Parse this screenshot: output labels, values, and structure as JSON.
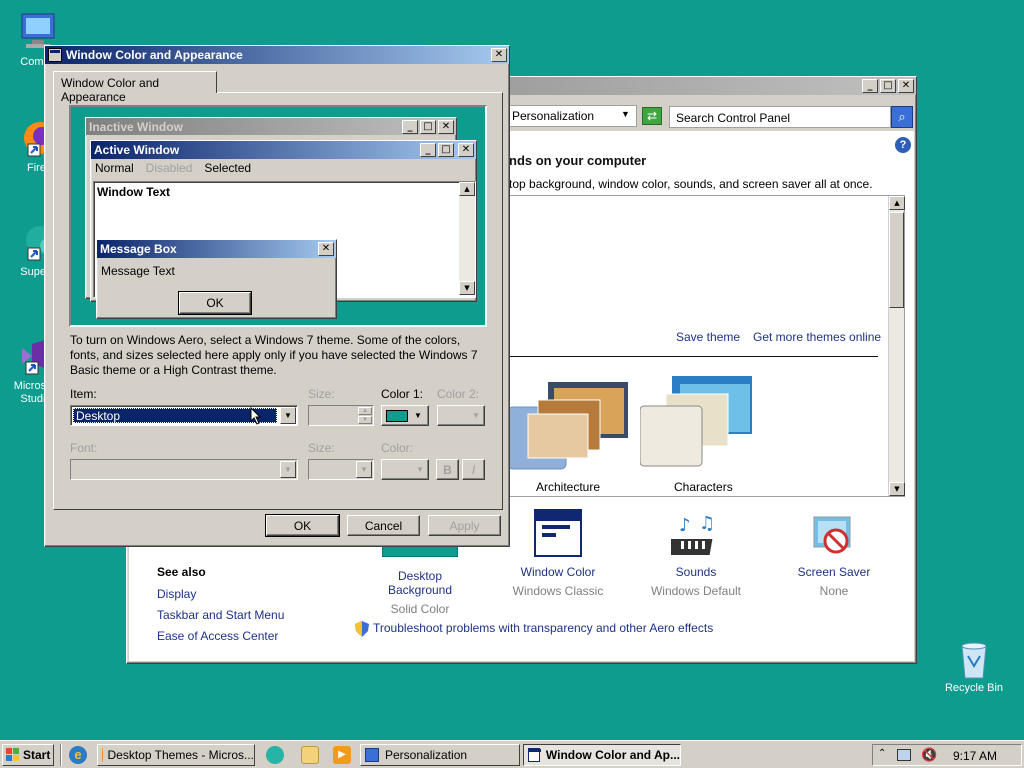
{
  "colors": {
    "desktop": "#0d9c8e",
    "active_title_start": "#0a246a",
    "active_title_end": "#a6caf0",
    "selection": "#0a246a",
    "color1_swatch": "#0d9c8e",
    "link": "#1e3287"
  },
  "desktop_icons": [
    {
      "label": "Compu",
      "icon": "computer-icon"
    },
    {
      "label": "Firef",
      "icon": "firefox-icon"
    },
    {
      "label": "Supern",
      "icon": "supernova-icon"
    },
    {
      "label": "Microsoft Studio",
      "icon": "visual-studio-icon"
    },
    {
      "label": "Recycle Bin",
      "icon": "recycle-bin-icon"
    }
  ],
  "personalization": {
    "address_text": "Personalization",
    "search_placeholder": "Search Control Panel",
    "heading": "nds on your computer",
    "subtext": "top background, window color, sounds, and screen saver all at once.",
    "save_theme": "Save theme",
    "get_more_themes": "Get more themes online",
    "themes": [
      {
        "label": "Architecture"
      },
      {
        "label": "Characters"
      }
    ],
    "bottom_items": [
      {
        "label": "Desktop Background",
        "sub": "Solid Color",
        "icon": "desktop-background-icon"
      },
      {
        "label": "Window Color",
        "sub": "Windows Classic",
        "icon": "window-color-icon"
      },
      {
        "label": "Sounds",
        "sub": "Windows Default",
        "icon": "sounds-icon"
      },
      {
        "label": "Screen Saver",
        "sub": "None",
        "icon": "screen-saver-icon"
      }
    ],
    "see_also": {
      "title": "See also",
      "links": [
        "Display",
        "Taskbar and Start Menu",
        "Ease of Access Center"
      ]
    },
    "troubleshoot": "Troubleshoot problems with transparency and other Aero effects"
  },
  "dialog": {
    "title": "Window Color and Appearance",
    "tab": "Window Color and Appearance",
    "preview": {
      "inactive_title": "Inactive Window",
      "active_title": "Active Window",
      "menu_normal": "Normal",
      "menu_disabled": "Disabled",
      "menu_selected": "Selected",
      "window_text": "Window Text",
      "msgbox_title": "Message Box",
      "msgbox_text": "Message Text",
      "msgbox_ok": "OK"
    },
    "info": "To turn on Windows Aero, select a Windows 7 theme.  Some of the colors, fonts, and sizes selected here apply only if you have selected the Windows 7 Basic theme or a High Contrast theme.",
    "item_label": "Item:",
    "item_value": "Desktop",
    "size_label": "Size:",
    "color1_label": "Color 1:",
    "color2_label": "Color 2:",
    "font_label": "Font:",
    "font_size_label": "Size:",
    "font_color_label": "Color:",
    "bold_label": "B",
    "italic_label": "I",
    "ok": "OK",
    "cancel": "Cancel",
    "apply": "Apply"
  },
  "taskbar": {
    "start": "Start",
    "buttons": [
      "Desktop Themes - Micros...",
      "Personalization",
      "Window Color and Ap..."
    ],
    "clock": "9:17 AM"
  }
}
